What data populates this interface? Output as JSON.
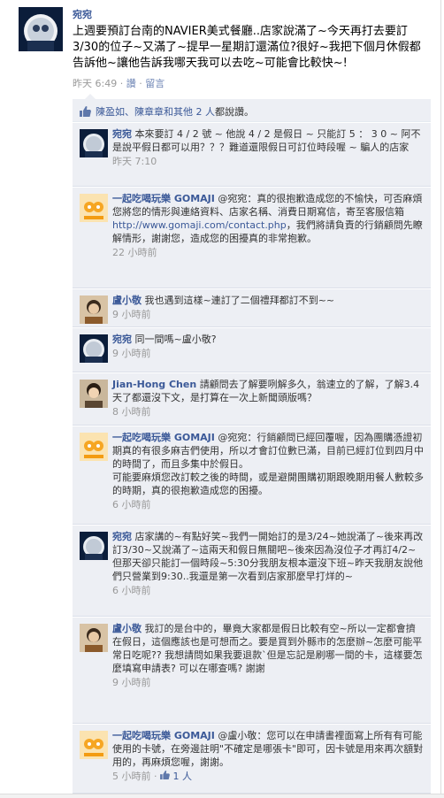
{
  "post": {
    "author": "宛宛",
    "text": "上週要預訂台南的NAVIER美式餐廳..店家說滿了~今天再打去要訂3/30的位子~又滿了~提早一星期訂還滿位?很好~我把下個月休假都告訴他~讓他告訴我哪天我可以去吃~可能會比較快~!",
    "time": "昨天 6:49",
    "sep": "·",
    "like_label": "讚",
    "comment_label": "留言"
  },
  "likes": {
    "names": "陳盈如、陳章章和其他 2 人",
    "suffix": "都說讚。"
  },
  "comments": [
    {
      "author": "宛宛",
      "text": "本來要訂 4 / 2 號 ~ 他說 4 / 2 是假日 ~ 只能訂 5 ： 3 0 ~ 阿不是說平假日都可以用？？？難道還限假日可訂位時段喔 ~ 騙人的店家",
      "time": "昨天 7:10"
    },
    {
      "author": "一起吃喝玩樂 GOMAJI",
      "text_a": "@宛宛：真的很抱歉造成您的不愉快，可否麻煩您將您的情形與連絡資料、店家名稱、消費日期寫信，寄至客服信箱",
      "link": "http://www.gomaji.com/contact.php",
      "text_b": "，我們將請負責的行銷顧問先瞭解情形，謝謝您，造成您的困擾真的非常抱歉。",
      "time": "22 小時前"
    },
    {
      "author": "盧小敬",
      "text": "我也遇到這樣~連訂了二個禮拜都訂不到~~",
      "time": "9 小時前"
    },
    {
      "author": "宛宛",
      "text": "同一間嗎~盧小敬?",
      "time": "9 小時前"
    },
    {
      "author": "Jian-Hong Chen",
      "text": "請顧問去了解要咧解多久，翁速立的了解，了解3.4天了都還沒下文，是打算在一次上新聞頭版嗎？",
      "time": "8 小時前"
    },
    {
      "author": "一起吃喝玩樂 GOMAJI",
      "text": "@宛宛：行銷顧問已經回覆喔，因為團購憑證初期真的有很多麻吉們使用，所以才會訂位數已滿，目前已經訂位到四月中的時間了，而且多集中於假日。\n可能要麻煩您改訂較之後的時間，或是避開團購初期跟晚期用餐人數較多的時期，真的很抱歉造成您的困擾。",
      "time": "6 小時前"
    },
    {
      "author": "宛宛",
      "text": "店家講的~有點好笑~我們一開始訂的是3/24~她說滿了~後來再改訂3/30~又說滿了~這兩天和假日無關吧~後來因為沒位子才再訂4/2~但那天卻只能訂一個時段~5:30分我朋友根本還沒下班~昨天我朋友說他們只營業到9:30..我還是第一次看到店家那麼早打烊的~",
      "time": "6 小時前"
    },
    {
      "author": "盧小敬",
      "text": "我訂的是台中的，畢竟大家都是假日比較有空~所以一定都會擠在假日，這個應該也是可想而之。要是買到外縣市的怎麼辦~怎麼可能平常日吃呢?? 我想請問如果我要退款`但是忘記是刷哪一間的卡，這樣要怎麼填寫申請表? 可以在哪查嗎? 謝謝",
      "time": "9 小時前"
    },
    {
      "author": "一起吃喝玩樂 GOMAJI",
      "text": "@盧小敬：您可以在申請書裡面寫上所有有可能使用的卡號，在旁邊註明\"不確定是哪張卡\"即可，因卡號是用來再次額對用的，再麻煩您喔，謝謝。",
      "time": "5 小時前",
      "like_count": "1 人"
    }
  ],
  "colors": {
    "link": "#3b5998",
    "ufi_bg": "#edeff4",
    "meta": "#999999"
  }
}
